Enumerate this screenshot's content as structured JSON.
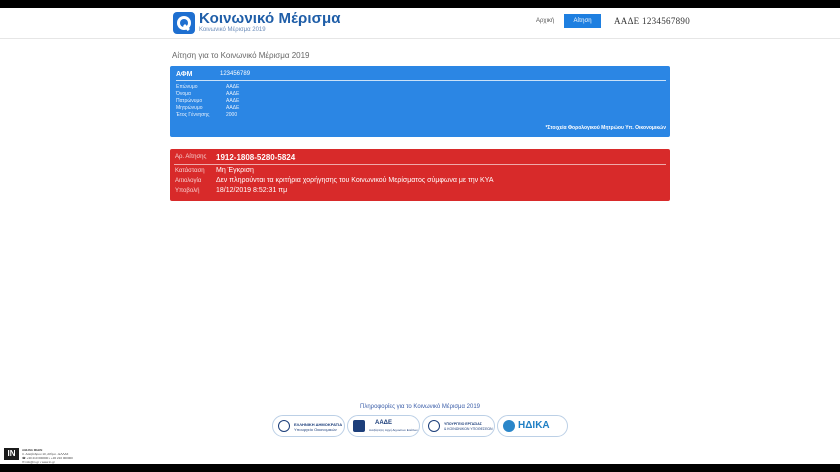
{
  "header": {
    "app_title": "Κοινωνικό Μέρισμα",
    "app_subtitle": "Κοινωνικό Μέρισμα 2019",
    "nav_home": "Αρχική",
    "nav_application": "Αίτηση",
    "user_label": "ΑΑΔΕ 1234567890"
  },
  "page_title": "Αίτηση για το Κοινωνικό Μέρισμα 2019",
  "taxpayer_card": {
    "afm_label": "ΑΦΜ",
    "afm_value": "123456789",
    "rows": [
      {
        "label": "Επώνυμο",
        "value": "ΑΑΔΕ"
      },
      {
        "label": "Όνομα",
        "value": "ΑΑΔΕ"
      },
      {
        "label": "Πατρώνυμο",
        "value": "ΑΑΔΕ"
      },
      {
        "label": "Μητρώνυμο",
        "value": "ΑΑΔΕ"
      },
      {
        "label": "Έτος Γέννησης",
        "value": "2000"
      }
    ],
    "note": "*Στοιχεία Φορολογικού Μητρώου Υπ. Οικονομικών"
  },
  "application_card": {
    "number_label": "Αρ. Αίτησης",
    "number_value": "1912-1808-5280-5824",
    "rows": [
      {
        "label": "Κατάσταση",
        "value": "Μη Έγκριση"
      },
      {
        "label": "Αιτιολογία",
        "value": "Δεν πληρούνται τα κριτήρια χορήγησης του Κοινωνικού Μερίσματος σύμφωνα με την ΚΥΑ"
      },
      {
        "label": "Υποβολή",
        "value": "18/12/2019 8:52:31 πμ"
      }
    ],
    "colors": {
      "background": "#d82a2a"
    }
  },
  "footer": {
    "info_link": "Πληροφορίες για το Κοινωνικό Μέρισμα 2019",
    "logos": [
      {
        "icon": "greek-republic-emblem-icon",
        "line1": "ΕΛΛΗΝΙΚΗ ΔΗΜΟΚΡΑΤΙΑ",
        "line2": "Υπουργείο Οικονομικών"
      },
      {
        "icon": "aade-logo-icon",
        "line1": "ΑΑΔΕ",
        "line2": "Ανεξάρτητη Αρχή Δημοσίων Εσόδων"
      },
      {
        "icon": "ministry-labour-emblem-icon",
        "line1": "ΥΠΟΥΡΓΕΙΟ ΕΡΓΑΣΙΑΣ",
        "line2": "& ΚΟΙΝΩΝΙΚΩΝ ΥΠΟΘΕΣΕΩΝ"
      },
      {
        "icon": "idika-logo-icon",
        "line1": "ΗΔΙΚΑ",
        "line2": ""
      }
    ]
  },
  "watermark": {
    "logo": "IN",
    "lines": [
      "ΑΘΗΝΑ ΜΙΔΙΝ",
      "Λ. Αλεξάνδρου 10, Αθήνα - ΕΛΛΑΣ",
      "☎ +30 210 000000 • +30 210 000000",
      "✉ info@in.gr • www.in.gr"
    ]
  },
  "colors": {
    "brand_blue": "#1f5ea8",
    "card_blue": "#2b86e4",
    "card_red": "#d82a2a",
    "nav_active": "#1e7fe0"
  }
}
